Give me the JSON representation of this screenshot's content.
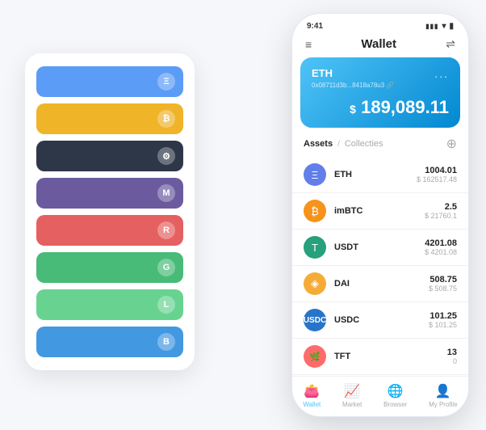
{
  "scene": {
    "background": "#f5f7fa"
  },
  "cardPanel": {
    "rows": [
      {
        "color": "blue",
        "iconText": "Ξ"
      },
      {
        "color": "yellow",
        "iconText": "₿"
      },
      {
        "color": "dark",
        "iconText": "⚙"
      },
      {
        "color": "purple",
        "iconText": "M"
      },
      {
        "color": "red",
        "iconText": "R"
      },
      {
        "color": "green",
        "iconText": "G"
      },
      {
        "color": "lightgreen",
        "iconText": "L"
      },
      {
        "color": "blue2",
        "iconText": "B"
      }
    ]
  },
  "phone": {
    "statusBar": {
      "time": "9:41",
      "signal": "●●●",
      "wifi": "▾",
      "battery": "▮"
    },
    "header": {
      "title": "Wallet",
      "menuIcon": "≡",
      "expandIcon": "⇌"
    },
    "ethCard": {
      "label": "ETH",
      "address": "0x08711d3b...8418a78u3",
      "addressSuffix": "🔗",
      "dots": "...",
      "balancePrefix": "$",
      "balance": "189,089.11"
    },
    "assets": {
      "activeTab": "Assets",
      "divider": "/",
      "inactiveTab": "Collecties",
      "addIcon": "⊕"
    },
    "assetList": [
      {
        "name": "ETH",
        "iconLabel": "Ξ",
        "iconClass": "asset-icon-eth",
        "amount": "1004.01",
        "usd": "$ 162517.48"
      },
      {
        "name": "imBTC",
        "iconLabel": "₿",
        "iconClass": "asset-icon-imbtc",
        "amount": "2.5",
        "usd": "$ 21760.1"
      },
      {
        "name": "USDT",
        "iconLabel": "T",
        "iconClass": "asset-icon-usdt",
        "amount": "4201.08",
        "usd": "$ 4201.08"
      },
      {
        "name": "DAI",
        "iconLabel": "◈",
        "iconClass": "asset-icon-dai",
        "amount": "508.75",
        "usd": "$ 508.75"
      },
      {
        "name": "USDC",
        "iconLabel": "©",
        "iconClass": "asset-icon-usdc",
        "amount": "101.25",
        "usd": "$ 101.25"
      },
      {
        "name": "TFT",
        "iconLabel": "🌿",
        "iconClass": "asset-icon-tft",
        "amount": "13",
        "usd": "0"
      }
    ],
    "bottomNav": [
      {
        "id": "wallet",
        "label": "Wallet",
        "icon": "👛",
        "active": true
      },
      {
        "id": "market",
        "label": "Market",
        "icon": "📈",
        "active": false
      },
      {
        "id": "browser",
        "label": "Browser",
        "icon": "🌐",
        "active": false
      },
      {
        "id": "profile",
        "label": "My Profile",
        "icon": "👤",
        "active": false
      }
    ]
  }
}
